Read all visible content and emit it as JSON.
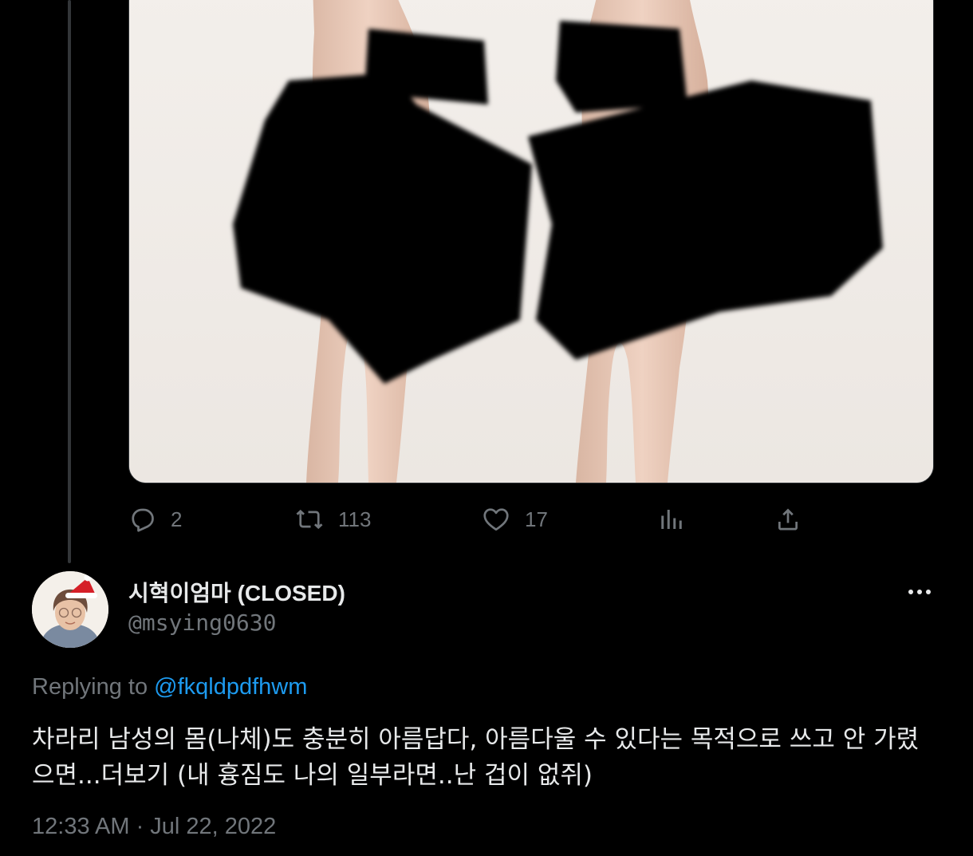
{
  "parent_tweet": {
    "media_alt": "",
    "actions": {
      "reply_count": "2",
      "retweet_count": "113",
      "like_count": "17"
    },
    "icons": {
      "reply": "reply-icon",
      "retweet": "retweet-icon",
      "like": "heart-icon",
      "views": "views-icon",
      "share": "share-icon"
    }
  },
  "reply_tweet": {
    "display_name": "시혁이엄마 (CLOSED)",
    "handle": "@msying0630",
    "replying_prefix": "Replying to ",
    "replying_handle": "@fkqldpdfhwm",
    "text_line_1": "차라리 남성의 몸(나체)도 충분히 아름답다, 아름다울 수 있다는 목적으로 쓰고 안 가렸",
    "text_line_2": "으면...더보기 (내 흉짐도 나의 일부라면..난 겁이 없쥐)",
    "timestamp": "12:33 AM · Jul 22, 2022",
    "more_icon": "more-horizontal-icon"
  },
  "colors": {
    "background": "#000000",
    "text_primary": "#e7e9ea",
    "text_secondary": "#71767b",
    "link": "#1d9bf0",
    "thread_line": "#333639"
  }
}
